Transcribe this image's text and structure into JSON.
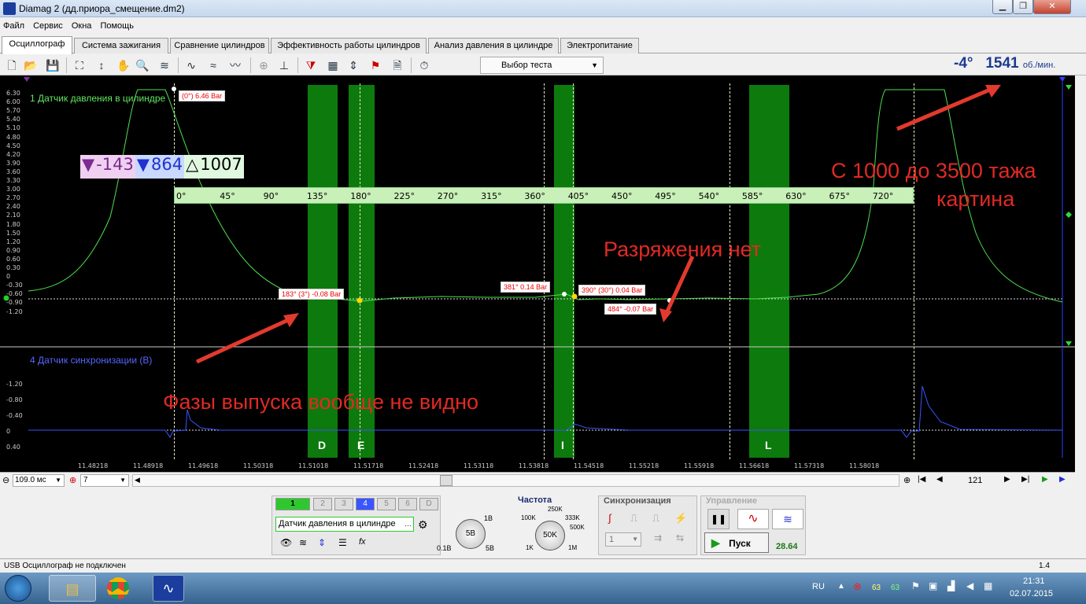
{
  "window": {
    "title": "Diamag 2 (дд.приора_смещение.dm2)"
  },
  "menu": [
    "Файл",
    "Сервис",
    "Окна",
    "Помощь"
  ],
  "tabs": [
    "Осциллограф",
    "Система зажигания",
    "Сравнение цилиндров",
    "Эффективность работы цилиндров",
    "Анализ давления в цилиндре",
    "Электропитание"
  ],
  "toolbar": {
    "test_select": "Выбор теста"
  },
  "readout": {
    "angle": "-4°",
    "rpm": "1541",
    "rpm_unit": "об./мин."
  },
  "scope": {
    "channel1_label": "1 Датчик давления в цилиндре",
    "channel4_label": "4 Датчик синхронизации (В)",
    "y_ticks_top": [
      "6.30",
      "6.00",
      "5.70",
      "5.40",
      "5.10",
      "4.80",
      "4.50",
      "4.20",
      "3.90",
      "3.60",
      "3.30",
      "3.00",
      "2.70",
      "2.40",
      "2.10",
      "1.80",
      "1.50",
      "1.20",
      "0.90",
      "0.60",
      "0.30",
      "0",
      "-0.30",
      "-0.60",
      "-0.90",
      "-1.20"
    ],
    "y_ticks_bottom": [
      "-1.20",
      "-0.80",
      "-0.40",
      "0",
      "0.40"
    ],
    "x_ticks": [
      "11.48218",
      "11.48918",
      "11.49618",
      "11.50318",
      "11.51018",
      "11.51718",
      "11.52418",
      "11.53118",
      "11.53818",
      "11.54518",
      "11.55218",
      "11.55918",
      "11.56618",
      "11.57318",
      "11.58018"
    ],
    "deg_ticks": [
      "0°",
      "45°",
      "90°",
      "135°",
      "180°",
      "225°",
      "270°",
      "315°",
      "360°",
      "405°",
      "450°",
      "495°",
      "540°",
      "585°",
      "630°",
      "675°",
      "720°"
    ],
    "band_labels": [
      "D",
      "E",
      "I",
      "L"
    ],
    "markers": {
      "m1": "(0°) 6.46 Bar",
      "m2": "183° (3°) -0.08 Bar",
      "m3": "381° 0.14 Bar",
      "m4": "390° (30°) 0.04 Bar",
      "m5": "484° -0.07 Bar"
    },
    "cursor_box": {
      "a": "-143",
      "b": "864",
      "delta": "1007"
    },
    "annotations": {
      "a1": "С 1000 до 3500 тажа",
      "a2": "картина",
      "a3": "Разряжения нет",
      "a4": "Фазы выпуска вообще не видно"
    }
  },
  "nav": {
    "timebase": "109.0 мс",
    "zoom": "7",
    "frame": "121"
  },
  "channels": [
    "1",
    "2",
    "3",
    "4",
    "5",
    "6",
    "D"
  ],
  "sensor": {
    "name": "Датчик давления в цилиндре"
  },
  "knob_voltage": {
    "value": "5В",
    "min": "0.1В",
    "max": "5В",
    "top": "1В"
  },
  "freq": {
    "title": "Частота",
    "value": "50K",
    "l1": "250K",
    "l2": "100K",
    "l3": "333K",
    "l4": "500K",
    "l5": "1K",
    "l6": "1M"
  },
  "sync": {
    "title": "Синхронизация",
    "channel": "1"
  },
  "control": {
    "title": "Управление",
    "start": "Пуск",
    "value": "28.64"
  },
  "status": {
    "left": "USB Осциллограф не подключен",
    "right": "1.4"
  },
  "taskbar": {
    "lang": "RU",
    "n1": "63",
    "n2": "63",
    "time": "21:31",
    "date": "02.07.2015"
  }
}
